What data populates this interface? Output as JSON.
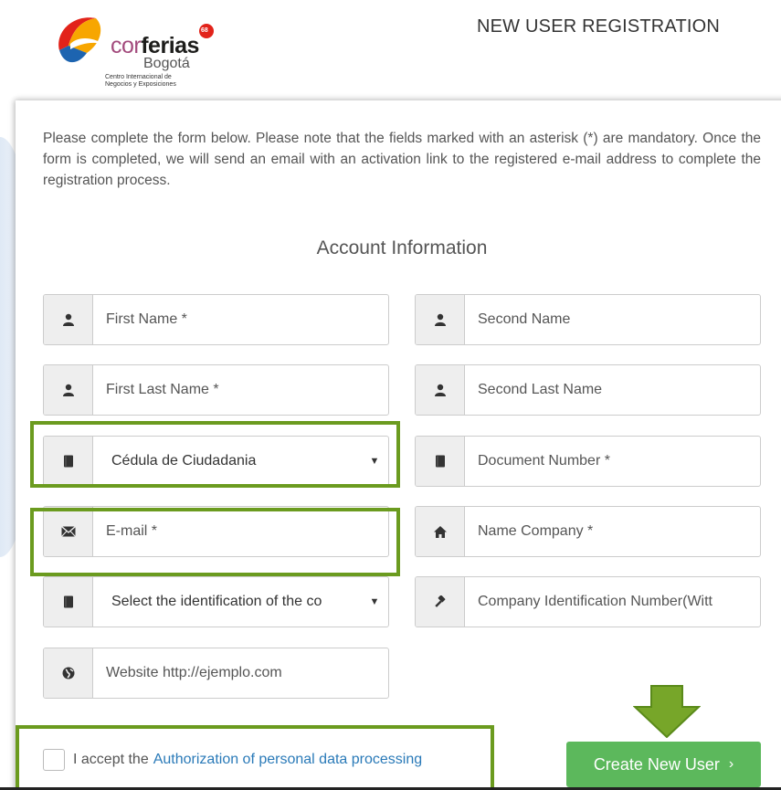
{
  "header": {
    "logo_brand_light": "cor",
    "logo_brand_bold": "ferias",
    "logo_city": "Bogotá",
    "logo_subtitle": "Centro Internacional de\nNegocios y Exposiciones",
    "logo_badge": "68",
    "page_title": "NEW USER REGISTRATION"
  },
  "intro_text": "Please complete the form below. Please note that the fields marked with an asterisk (*) are mandatory. Once the form is completed, we will send an email with an activation link to the registered e-mail address to complete the registration process.",
  "section_title": "Account Information",
  "fields": {
    "first_name": {
      "placeholder": "First Name *",
      "icon": "user-icon"
    },
    "second_name": {
      "placeholder": "Second Name",
      "icon": "user-icon"
    },
    "first_last_name": {
      "placeholder": "First Last Name *",
      "icon": "user-icon"
    },
    "second_last_name": {
      "placeholder": "Second Last Name",
      "icon": "user-icon"
    },
    "document_type": {
      "value": "Cédula de Ciudadania",
      "icon": "book-icon"
    },
    "document_number": {
      "placeholder": "Document Number *",
      "icon": "book-icon"
    },
    "email": {
      "placeholder": "E-mail *",
      "icon": "envelope-icon"
    },
    "company_name": {
      "placeholder": "Name Company *",
      "icon": "home-icon"
    },
    "company_id_type": {
      "value": "Select the identification of the co",
      "icon": "book-icon"
    },
    "company_id_number": {
      "placeholder": "Company Identification Number(Witt",
      "icon": "gavel-icon"
    },
    "website": {
      "placeholder": "Website http://ejemplo.com",
      "icon": "globe-icon"
    }
  },
  "terms": {
    "prefix": "I accept the",
    "link": "Authorization of personal data processing"
  },
  "submit_label": "Create New User",
  "colors": {
    "highlight": "#6b9b1f",
    "button": "#5cb85c",
    "link": "#2a7ab8"
  }
}
